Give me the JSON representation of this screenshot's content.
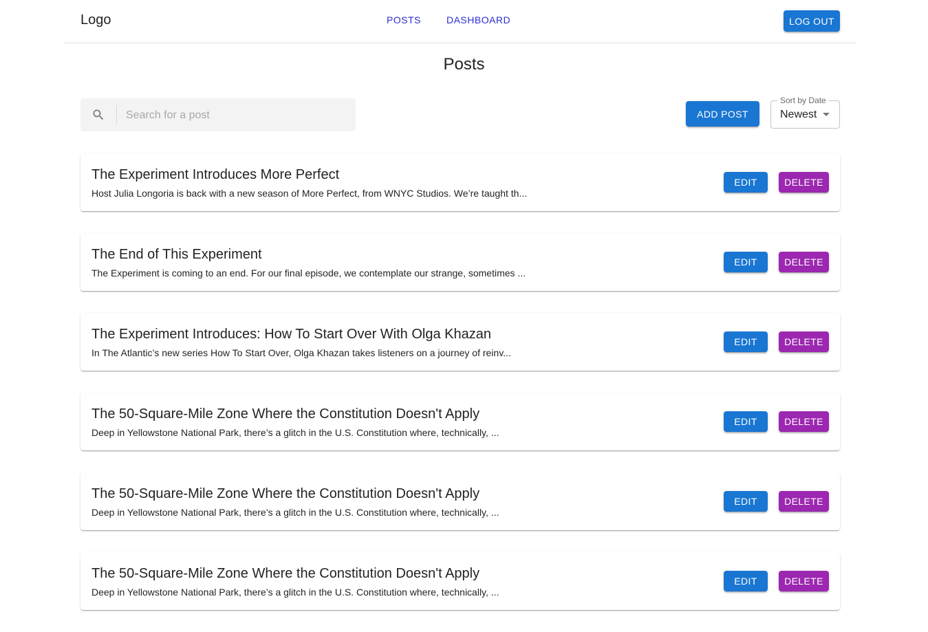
{
  "header": {
    "logo": "Logo",
    "nav": [
      {
        "label": "POSTS"
      },
      {
        "label": "DASHBOARD"
      }
    ],
    "logout_label": "LOG OUT"
  },
  "page_title": "Posts",
  "search": {
    "placeholder": "Search for a post",
    "icon": "search-icon"
  },
  "add_post_label": "ADD POST",
  "sort": {
    "label": "Sort by Date",
    "value": "Newest"
  },
  "posts": [
    {
      "title": "The Experiment Introduces More Perfect",
      "excerpt": "Host Julia Longoria is back with a new season of More Perfect, from WNYC Studios. We’re taught th...",
      "edit": "EDIT",
      "delete": "DELETE"
    },
    {
      "title": "The End of This Experiment",
      "excerpt": "The Experiment is coming to an end. For our final episode, we contemplate our strange, sometimes ...",
      "edit": "EDIT",
      "delete": "DELETE"
    },
    {
      "title": "The Experiment Introduces: How To Start Over With Olga Khazan",
      "excerpt": "In The Atlantic’s new series How To Start Over, Olga Khazan takes listeners on a journey of reinv...",
      "edit": "EDIT",
      "delete": "DELETE"
    },
    {
      "title": "The 50-Square-Mile Zone Where the Constitution Doesn't Apply",
      "excerpt": "Deep in Yellowstone National Park, there’s a glitch in the U.S. Constitution where, technically, ...",
      "edit": "EDIT",
      "delete": "DELETE"
    },
    {
      "title": "The 50-Square-Mile Zone Where the Constitution Doesn't Apply",
      "excerpt": "Deep in Yellowstone National Park, there’s a glitch in the U.S. Constitution where, technically, ...",
      "edit": "EDIT",
      "delete": "DELETE"
    },
    {
      "title": "The 50-Square-Mile Zone Where the Constitution Doesn't Apply",
      "excerpt": "Deep in Yellowstone National Park, there’s a glitch in the U.S. Constitution where, technically, ...",
      "edit": "EDIT",
      "delete": "DELETE"
    }
  ],
  "colors": {
    "primary": "#1976d2",
    "secondary": "#9c27b0",
    "nav_link": "#2b2bd0"
  }
}
